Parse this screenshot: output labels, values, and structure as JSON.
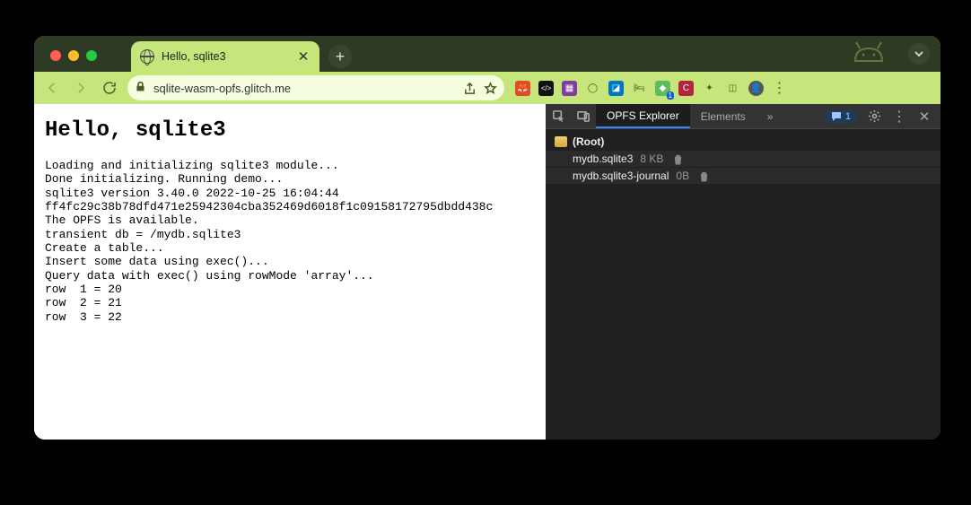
{
  "window": {
    "traffic_lights": [
      "close",
      "minimize",
      "zoom"
    ]
  },
  "tab": {
    "title": "Hello, sqlite3"
  },
  "nav": {
    "back": "←",
    "forward": "→",
    "reload": "⟳"
  },
  "omnibox": {
    "url": "sqlite-wasm-opfs.glitch.me"
  },
  "extensions": [
    {
      "name": "whatruns",
      "bg": "#e24a2b",
      "glyph": "🦊"
    },
    {
      "name": "code-ext",
      "bg": "#111",
      "glyph": "</>"
    },
    {
      "name": "pixel-ext",
      "bg": "#7e3fa0",
      "glyph": "◧"
    },
    {
      "name": "grammarly",
      "bg": "#c6e57a",
      "glyph": "○"
    },
    {
      "name": "trello",
      "bg": "#0079bf",
      "glyph": "◪"
    },
    {
      "name": "bed-ext",
      "bg": "#c6e57a",
      "glyph": "🛏"
    },
    {
      "name": "perf-ext",
      "bg": "#60bb60",
      "glyph": "◆"
    },
    {
      "name": "clip-ext",
      "bg": "#b0273a",
      "glyph": "C"
    },
    {
      "name": "puzzle",
      "bg": "transparent",
      "glyph": "🧩"
    },
    {
      "name": "sidepanel",
      "bg": "transparent",
      "glyph": "◫"
    },
    {
      "name": "avatar",
      "bg": "#555",
      "glyph": "👤"
    },
    {
      "name": "menu",
      "bg": "transparent",
      "glyph": "⋮"
    }
  ],
  "page": {
    "heading": "Hello, sqlite3",
    "log": "Loading and initializing sqlite3 module...\nDone initializing. Running demo...\nsqlite3 version 3.40.0 2022-10-25 16:04:44\nff4fc29c38b78dfd471e25942304cba352469d6018f1c09158172795dbdd438c\nThe OPFS is available.\ntransient db = /mydb.sqlite3\nCreate a table...\nInsert some data using exec()...\nQuery data with exec() using rowMode 'array'...\nrow  1 = 20\nrow  2 = 21\nrow  3 = 22"
  },
  "devtools": {
    "tabs": {
      "active": "OPFS Explorer",
      "next": "Elements",
      "overflow": "»"
    },
    "messages_count": "1",
    "root_label": "(Root)",
    "files": [
      {
        "name": "mydb.sqlite3",
        "size": "8 KB"
      },
      {
        "name": "mydb.sqlite3-journal",
        "size": "0B"
      }
    ]
  }
}
